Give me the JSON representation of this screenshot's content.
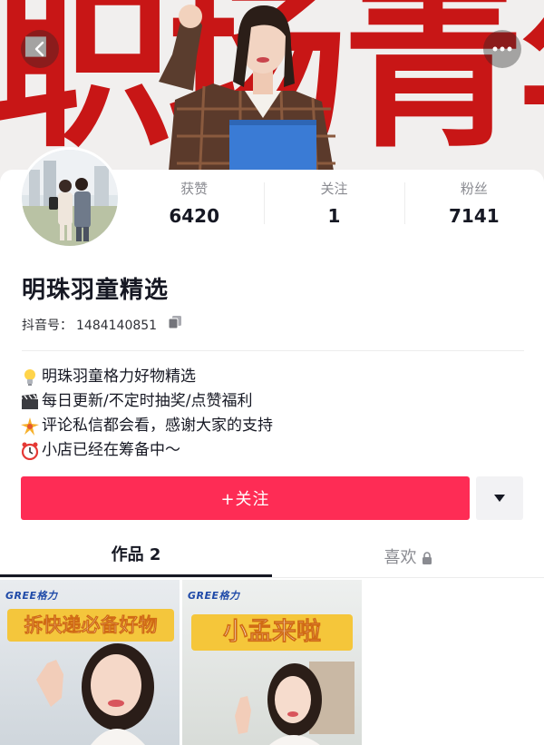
{
  "banner": {
    "headline_text": "职场青年",
    "colors": {
      "red": "#c81616",
      "background": "#f1efee",
      "folder": "#3a7bd5"
    }
  },
  "nav": {
    "back_icon": "chevron-left-icon",
    "more_icon": "more-dots-icon"
  },
  "stats": [
    {
      "label": "获赞",
      "value": "6420"
    },
    {
      "label": "关注",
      "value": "1"
    },
    {
      "label": "粉丝",
      "value": "7141"
    }
  ],
  "profile": {
    "name": "明珠羽童精选",
    "douyin_id_label": "抖音号：",
    "douyin_id": "1484140851"
  },
  "bio": [
    {
      "icon": "lightbulb-icon",
      "text": "明珠羽童格力好物精选"
    },
    {
      "icon": "clapperboard-icon",
      "text": "每日更新/不定时抽奖/点赞福利"
    },
    {
      "icon": "sparkle-icon",
      "text": "评论私信都会看，感谢大家的支持"
    },
    {
      "icon": "alarm-clock-icon",
      "text": "小店已经在筹备中～"
    }
  ],
  "actions": {
    "follow_label": "+关注",
    "accent_color": "#fe2c55"
  },
  "tabs": [
    {
      "label": "作品 2",
      "active": true
    },
    {
      "label": "喜欢",
      "active": false,
      "locked": true
    }
  ],
  "videos": [
    {
      "brand": "GREE格力",
      "caption": "拆快递必备好物"
    },
    {
      "brand": "GREE格力",
      "caption": "小孟来啦"
    }
  ]
}
